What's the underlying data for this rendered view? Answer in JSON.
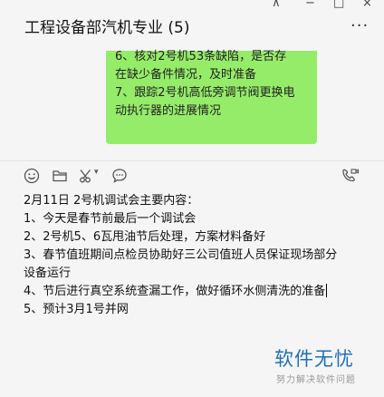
{
  "window": {
    "title": "工程设备部汽机专业 (5)",
    "controls": {
      "pin": "⊼",
      "minimize": "−",
      "maximize": "□",
      "close": "×"
    },
    "more_label": "···"
  },
  "message": {
    "lines": [
      "6、核对2号机53条缺陷，是否存",
      "在缺少备件情况，及时准备",
      "7、跟踪2号机高低旁调节阀更换电",
      "动执行器的进展情况"
    ],
    "bubble_color": "#95ec69"
  },
  "toolbar": {
    "icons": [
      "emoji-icon",
      "folder-icon",
      "scissors-icon",
      "chat-bubble-icon",
      "video-call-icon"
    ],
    "scissors_menu": "▾"
  },
  "editor": {
    "lines": [
      "2月11日 2号机调试会主要内容：",
      "1、今天是春节前最后一个调试会",
      "2、2号机5、6瓦甩油节后处理，方案材料备好",
      "3、春节值班期间点检员协助好三公司值班人员保证现场部分",
      "设备运行",
      "4、节后进行真空系统查漏工作，做好循环水侧清洗的准备",
      "5、预计3月1号并网"
    ]
  },
  "watermark": {
    "main": "软件无忧",
    "sub": "努力解决软件问题",
    "color": "#1f6fb5"
  }
}
